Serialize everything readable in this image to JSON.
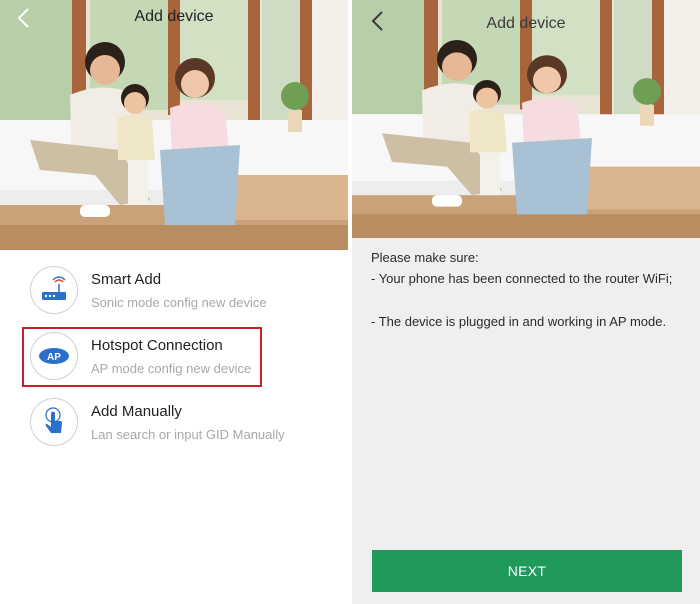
{
  "left": {
    "header": {
      "title": "Add device",
      "back_icon": "chevron-left-icon"
    },
    "options": [
      {
        "title": "Smart Add",
        "subtitle": "Sonic mode config new device",
        "icon": "router-icon"
      },
      {
        "title": "Hotspot Connection",
        "subtitle": "AP mode config new device",
        "icon": "ap-badge-icon",
        "badge_text": "AP"
      },
      {
        "title": "Add Manually",
        "subtitle": "Lan search or input GID Manually",
        "icon": "tap-hand-icon"
      }
    ],
    "highlighted_option": "Hotspot Connection"
  },
  "right": {
    "header": {
      "title": "Add device",
      "back_icon": "chevron-left-icon"
    },
    "instructions": {
      "heading": "Please make sure:",
      "items": [
        "- Your phone has been connected to the router WiFi;",
        "- The device is plugged in and working in AP mode."
      ]
    },
    "next_button": "NEXT"
  },
  "colors": {
    "accent_green": "#1f9a5a",
    "highlight_red": "#c8202a",
    "icon_blue": "#2a6fc9",
    "right_background": "#efefef"
  }
}
